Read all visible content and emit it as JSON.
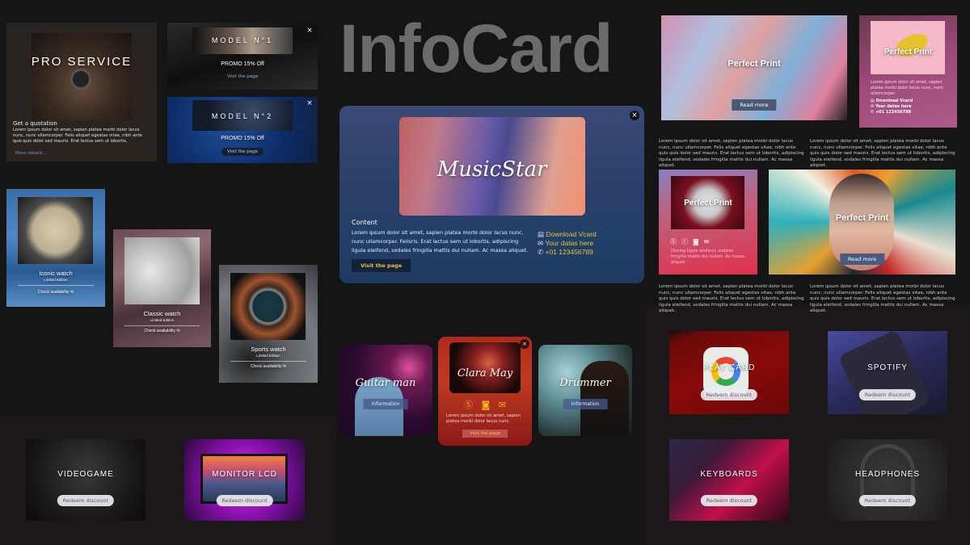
{
  "title": "InfoCard",
  "pro_service": {
    "heading": "PRO SERVICE",
    "subtitle": "Get a quotation",
    "body": "Lorem ipsum dolor sit amet, sapien platea morbi dolor lacus nunc, nunc ullamcorper. Felis aliquet egestas vitae, nibh ante quis quis dolor sed mauris. Erat lectus sem ut lobortis.",
    "link": "More details..."
  },
  "models": [
    {
      "name": "MODEL N°1",
      "promo": "PROMO 15% Off",
      "button": "Visit the page",
      "close": "×"
    },
    {
      "name": "MODEL N°2",
      "promo": "PROMO 15% Off",
      "button": "Visit the page",
      "close": "×"
    }
  ],
  "watches": [
    {
      "name": "Iconic watch",
      "edition": "Limited Edition",
      "action": "Check availability",
      "icon": "mail-icon"
    },
    {
      "name": "Classic watch",
      "edition": "Limited Edition",
      "action": "Check availability",
      "icon": "mail-icon"
    },
    {
      "name": "Sports watch",
      "edition": "Limited Edition",
      "action": "Check availability",
      "icon": "mail-icon"
    }
  ],
  "music_star": {
    "name": "MusicStar",
    "heading": "Content",
    "body": "Lorem ipsum dolor sit amet, sapien platea morbi dolor lacus nunc, nunc ullamcorper. Felisris. Erat lectus sem ut lobortis, adipiscing ligula eleifend, sodales fringilla mattis dui nullam. Ac massa aliquet.",
    "button": "Visit the page",
    "close": "×",
    "contacts": [
      {
        "icon": "vcard-icon",
        "label": "Download Vcard"
      },
      {
        "icon": "mail-icon",
        "label": "Your datas here"
      },
      {
        "icon": "phone-icon",
        "label": "+01 123456789"
      }
    ],
    "accent": "#e8c33a"
  },
  "artists": [
    {
      "name": "Guitar man",
      "button": "Information"
    },
    {
      "name": "Clara May",
      "body": "Lorem ipsum dolor sit amet, sapien platea morbi dolor lacus nunc.",
      "button": "Visit the page",
      "close": "×",
      "icons": [
        "skype-icon",
        "instagram-icon",
        "mail-icon"
      ]
    },
    {
      "name": "Drummer",
      "button": "Information"
    }
  ],
  "perfect_print": {
    "title": "Perfect Print",
    "read_more": "Read more",
    "banana_body": "Lorem ipsum dolor sit amet, sapien platea morbi dolor lacus nunc, nunc ullamcorper.",
    "banana_contacts": [
      "Download Vcard",
      "Your datas here",
      "+01 123456789"
    ],
    "mug_body": "Disсing ligula eleifend, sodales fringilla mattis dui nullam. Ac massa aliquet.",
    "mug_icons": [
      "skype-icon",
      "facebook-icon",
      "instagram-icon",
      "mail-icon"
    ],
    "lorem": "Lorem ipsum dolor sit amet, sapien platea morbi dolor lacus nunc, nunc ullamcorper. Felis aliquet egestas vitae, nibh ante quis quis dolor sed mauris. Erat lectus sem ut lobortis, adipiscing ligula eleifend, sodales fringilla mattis dui nullam. Ac massa aliquet."
  },
  "discounts": [
    {
      "name": "VIDEOGAME",
      "button": "Redeem discount"
    },
    {
      "name": "MONITOR LCD",
      "button": "Redeem discount"
    },
    {
      "name": "PLAY CARD",
      "button": "Redeem discount"
    },
    {
      "name": "SPOTIFY",
      "button": "Redeem discount"
    },
    {
      "name": "KEYBOARDS",
      "button": "Redeem discount"
    },
    {
      "name": "HEADPHONES",
      "button": "Redeem discount"
    }
  ]
}
